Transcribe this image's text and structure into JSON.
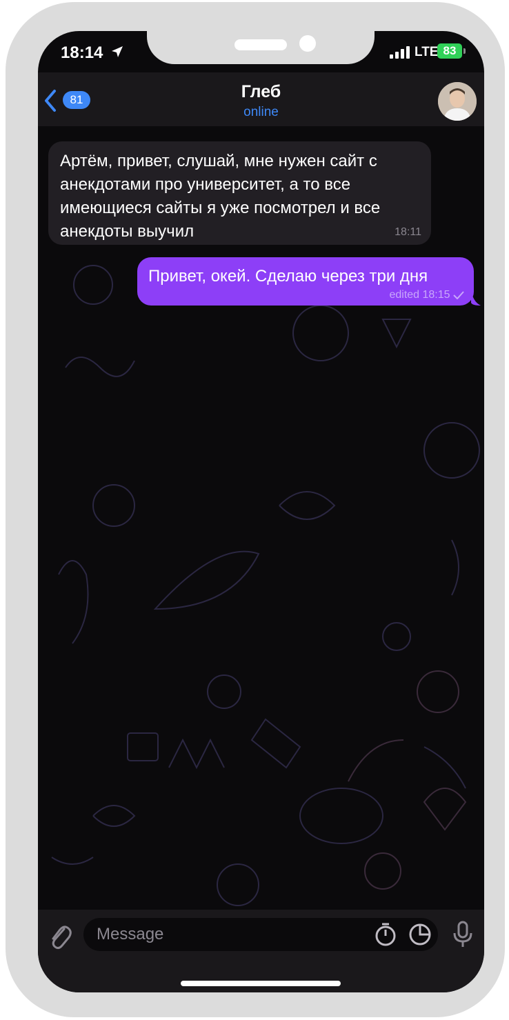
{
  "status_bar": {
    "time": "18:14",
    "network": "LTE",
    "battery": "83"
  },
  "header": {
    "back_count": "81",
    "chat_name": "Глеб",
    "chat_status": "online"
  },
  "messages": [
    {
      "direction": "incoming",
      "text": "Артём, привет, слушай, мне нужен сайт с анекдотами про университет, а то все имеющиеся сайты я уже посмотрел и все анекдоты выучил",
      "time": "18:11"
    },
    {
      "direction": "outgoing",
      "text": "Привет, окей. Сделаю через три дня",
      "meta": "edited 18:15"
    }
  ],
  "input": {
    "placeholder": "Message"
  },
  "colors": {
    "accent": "#3e88f7",
    "outgoing_bubble": "#8d3ff7",
    "incoming_bubble": "#221f24",
    "background": "#0b0a0c"
  }
}
